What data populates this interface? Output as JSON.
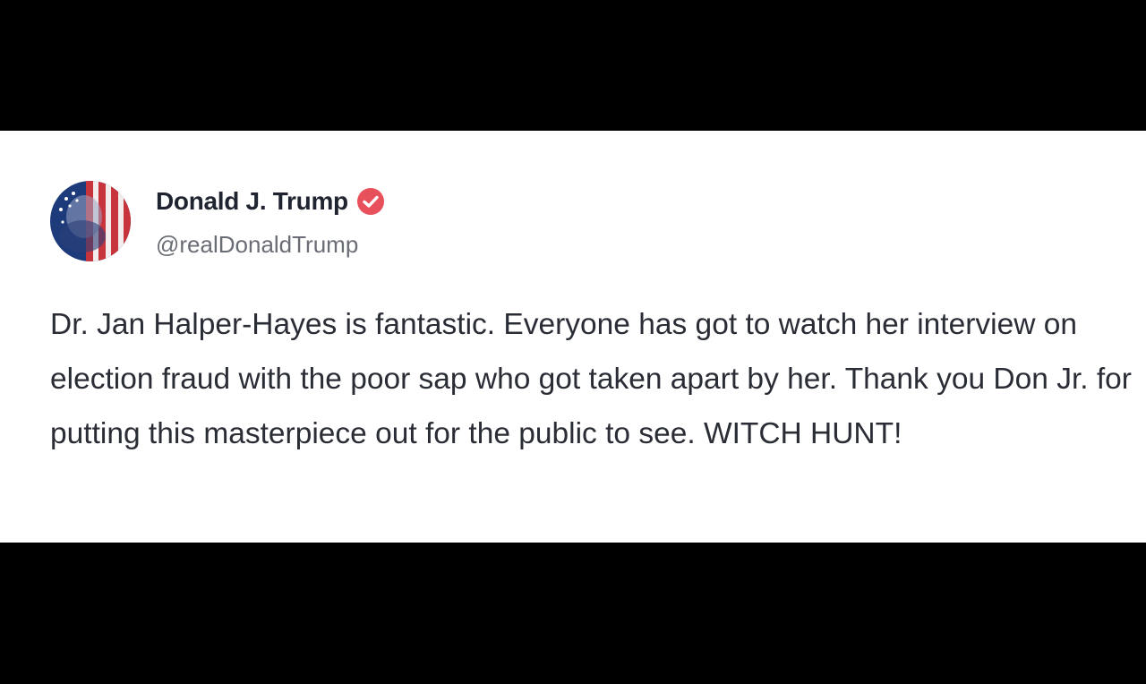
{
  "post": {
    "author": {
      "display_name": "Donald J. Trump",
      "handle": "@realDonaldTrump",
      "verified": true,
      "avatar_icon": "flag-portrait-avatar",
      "badge_icon": "verified-check-icon"
    },
    "text": "Dr. Jan Halper-Hayes is fantastic. Everyone has got to watch her interview on election fraud with the poor sap who got taken apart by her. Thank you Don Jr. for putting this masterpiece out for the public to see. WITCH HUNT!"
  },
  "colors": {
    "background_bars": "#000000",
    "card": "#ffffff",
    "name_text": "#1f2430",
    "handle_text": "#6a6d75",
    "body_text": "#2a2d35",
    "verified_badge": "#e8505b",
    "avatar_red": "#c8343c",
    "avatar_blue": "#1d3a7a"
  }
}
